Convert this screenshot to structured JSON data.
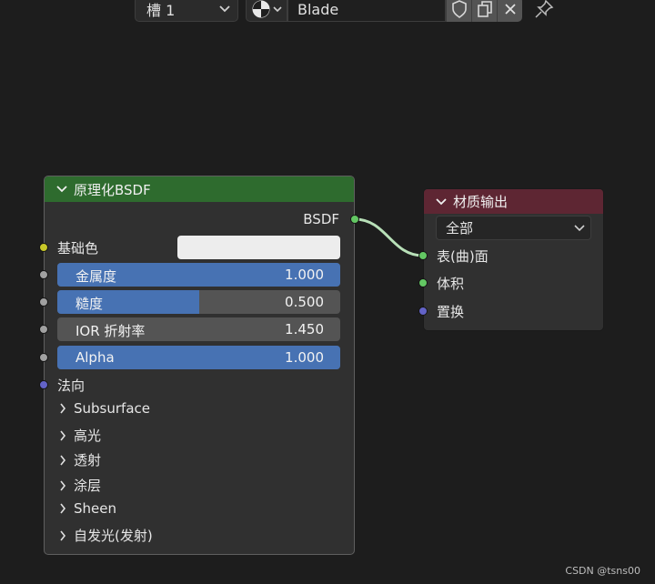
{
  "header": {
    "slot_label": "槽 1",
    "material_name": "Blade"
  },
  "bsdf_node": {
    "title": "原理化BSDF",
    "output_label": "BSDF",
    "base_color_label": "基础色",
    "base_color_value": "#ededed",
    "inputs": [
      {
        "label": "金属度",
        "value": "1.000",
        "fill": 1.0
      },
      {
        "label": "糙度",
        "value": "0.500",
        "fill": 0.5
      },
      {
        "label": "IOR 折射率",
        "value": "1.450",
        "fill": 0.0
      },
      {
        "label": "Alpha",
        "value": "1.000",
        "fill": 1.0
      }
    ],
    "normal_label": "法向",
    "panels": [
      "Subsurface",
      "高光",
      "透射",
      "涂层",
      "Sheen",
      "自发光(发射)"
    ]
  },
  "output_node": {
    "title": "材质输出",
    "target": "全部",
    "inputs": [
      "表(曲)面",
      "体积",
      "置换"
    ]
  },
  "colors": {
    "bsdf_header": "#2e6b2e",
    "output_header": "#5e2633",
    "slider_fill": "#4772b3",
    "socket_shader": "#63c763",
    "socket_float": "#a1a1a1",
    "socket_color": "#c7c729",
    "socket_vector": "#6363c7"
  },
  "watermark": "CSDN @tsns00"
}
